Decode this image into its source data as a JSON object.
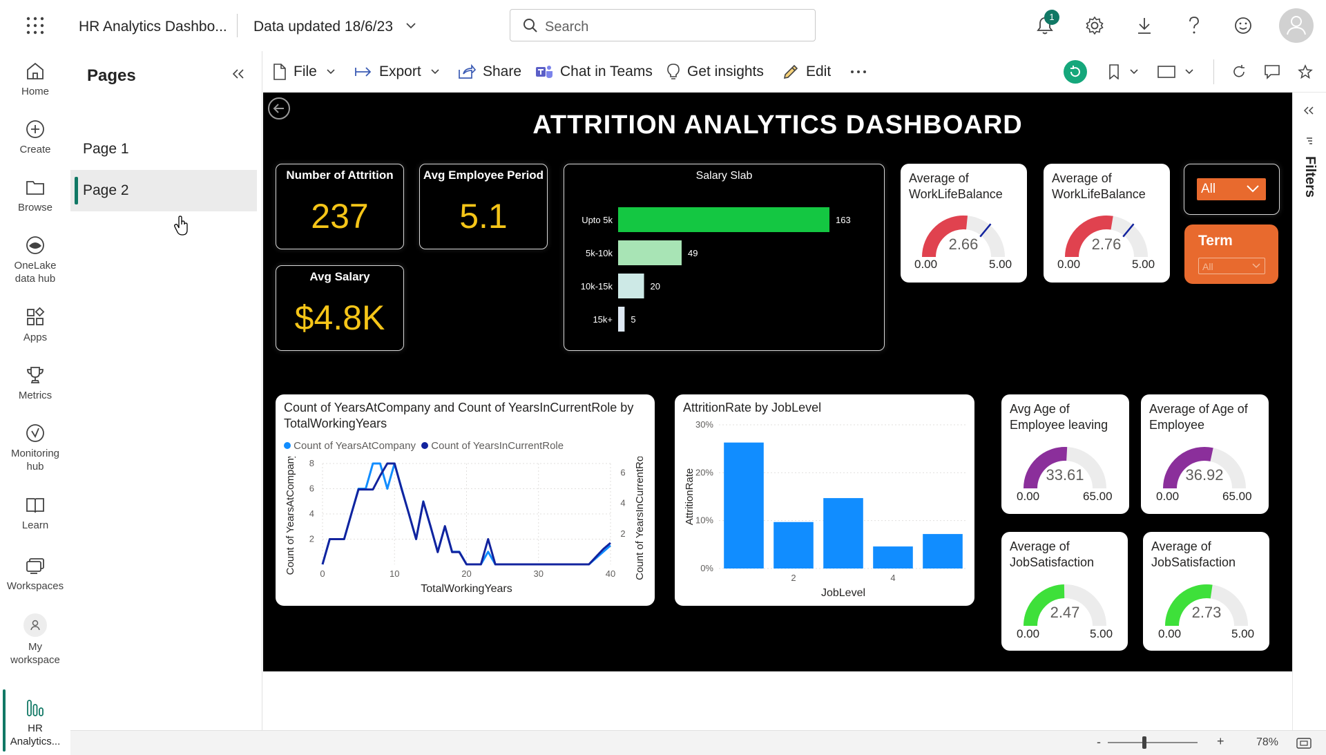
{
  "topbar": {
    "report_title": "HR Analytics Dashbo...",
    "data_updated": "Data updated 18/6/23",
    "search_placeholder": "Search",
    "notification_count": "1"
  },
  "rail": {
    "items": [
      {
        "label": "Home"
      },
      {
        "label": "Create"
      },
      {
        "label": "Browse"
      },
      {
        "label": "OneLake data hub"
      },
      {
        "label": "Apps"
      },
      {
        "label": "Metrics"
      },
      {
        "label": "Monitoring hub"
      },
      {
        "label": "Learn"
      },
      {
        "label": "Workspaces"
      },
      {
        "label": "My workspace"
      },
      {
        "label": "HR Analytics..."
      }
    ]
  },
  "pages_pane": {
    "title": "Pages",
    "pages": [
      {
        "label": "Page 1"
      },
      {
        "label": "Page 2"
      }
    ]
  },
  "toolbar": {
    "file": "File",
    "export": "Export",
    "share": "Share",
    "chat": "Chat in Teams",
    "insights": "Get insights",
    "edit": "Edit"
  },
  "filters_label": "Filters",
  "report": {
    "title": "ATTRITION ANALYTICS DASHBOARD",
    "kpis": {
      "attrition": {
        "label": "Number of Attrition",
        "value": "237"
      },
      "period": {
        "label": "Avg Employee Period",
        "value": "5.1"
      },
      "salary": {
        "label": "Avg Salary",
        "value": "$4.8K"
      }
    },
    "slicers": {
      "all_value": "All",
      "term_label": "Term",
      "term_value": "All"
    },
    "gauges": [
      {
        "title": "Average of WorkLifeBalance",
        "value": "2.66",
        "min": "0.00",
        "max": "5.00",
        "fraction": 0.532,
        "target_fraction": 0.72,
        "color": "#e0424f"
      },
      {
        "title": "Average of WorkLifeBalance",
        "value": "2.76",
        "min": "0.00",
        "max": "5.00",
        "fraction": 0.552,
        "target_fraction": 0.72,
        "color": "#e0424f"
      },
      {
        "title": "Avg Age of Employee leaving",
        "value": "33.61",
        "min": "0.00",
        "max": "65.00",
        "fraction": 0.517,
        "color": "#8b2f9b"
      },
      {
        "title": "Average of Age of Employee",
        "value": "36.92",
        "min": "0.00",
        "max": "65.00",
        "fraction": 0.568,
        "color": "#8b2f9b"
      },
      {
        "title": "Average of JobSatisfaction",
        "value": "2.47",
        "min": "0.00",
        "max": "5.00",
        "fraction": 0.494,
        "color": "#3ee03a"
      },
      {
        "title": "Average of JobSatisfaction",
        "value": "2.73",
        "min": "0.00",
        "max": "5.00",
        "fraction": 0.546,
        "color": "#3ee03a"
      }
    ]
  },
  "status": {
    "zoom": "78%"
  },
  "chart_data": [
    {
      "type": "bar",
      "orientation": "horizontal",
      "title": "Salary Slab",
      "categories": [
        "Upto 5k",
        "5k-10k",
        "10k-15k",
        "15k+"
      ],
      "values": [
        163,
        49,
        20,
        5
      ],
      "colors": [
        "#14c742",
        "#a8e4b5",
        "#cde9e6",
        "#dde8f2"
      ]
    },
    {
      "type": "line",
      "title": "Count of YearsAtCompany and Count of YearsInCurrentRole by TotalWorkingYears",
      "xlabel": "TotalWorkingYears",
      "ylabel": "Count of YearsAtCompany",
      "y2label": "Count of YearsInCurrentRole",
      "xlim": [
        0,
        40
      ],
      "ylim": [
        0,
        8
      ],
      "y2lim": [
        0,
        6.6
      ],
      "x_ticks": [
        0,
        10,
        20,
        30,
        40
      ],
      "y_ticks": [
        2,
        4,
        6,
        8
      ],
      "y2_ticks": [
        2,
        4,
        6
      ],
      "series": [
        {
          "name": "Count of YearsAtCompany",
          "color": "#118dff",
          "x": [
            0,
            1,
            2,
            3,
            4,
            5,
            6,
            7,
            8,
            9,
            10,
            11,
            12,
            13,
            14,
            15,
            16,
            17,
            18,
            19,
            20,
            21,
            22,
            23,
            24,
            25,
            26,
            27,
            28,
            29,
            30,
            31,
            32,
            33,
            34,
            35,
            36,
            37,
            38,
            39,
            40
          ],
          "y": [
            0,
            2,
            2,
            2,
            4,
            6,
            6,
            8,
            8,
            6,
            8,
            6,
            4,
            2,
            5,
            3,
            1,
            3,
            1,
            1,
            0,
            0,
            0,
            1,
            0,
            0,
            0,
            0,
            0,
            0,
            0,
            0,
            0,
            0,
            0,
            0,
            0,
            0,
            0.5,
            1,
            1.5
          ]
        },
        {
          "name": "Count of YearsInCurrentRole",
          "color": "#12239e",
          "x": [
            0,
            1,
            2,
            3,
            4,
            5,
            6,
            7,
            8,
            9,
            10,
            11,
            12,
            13,
            14,
            15,
            16,
            17,
            18,
            19,
            20,
            21,
            22,
            23,
            24,
            25,
            26,
            27,
            28,
            29,
            30,
            31,
            32,
            33,
            34,
            35,
            36,
            37,
            38,
            39,
            40
          ],
          "y": [
            0,
            1.65,
            1.65,
            1.65,
            3.3,
            4.9,
            4.9,
            4.9,
            5.8,
            6.6,
            6.6,
            4.9,
            3.3,
            1.65,
            4.1,
            2.5,
            0.8,
            2.5,
            0.8,
            0.8,
            0,
            0,
            0,
            1.65,
            0,
            0,
            0,
            0,
            0,
            0,
            0,
            0,
            0,
            0,
            0,
            0,
            0,
            0,
            0.5,
            1,
            1.4
          ]
        }
      ]
    },
    {
      "type": "bar",
      "title": "AttritionRate by JobLevel",
      "xlabel": "JobLevel",
      "ylabel": "AttritionRate",
      "categories": [
        1,
        2,
        3,
        4,
        5
      ],
      "x_ticks": [
        2,
        4
      ],
      "values": [
        26.3,
        9.7,
        14.7,
        4.6,
        7.2
      ],
      "ylim": [
        0,
        30
      ],
      "y_ticks": [
        "0%",
        "10%",
        "20%",
        "30%"
      ],
      "color": "#118dff"
    }
  ]
}
